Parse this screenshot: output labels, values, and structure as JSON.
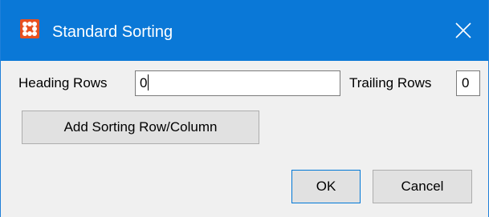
{
  "window": {
    "title": "Standard Sorting",
    "icon": "app-logo-icon",
    "close_icon": "close-icon",
    "titlebar_color": "#0a78d7",
    "icon_color": "#e8501f"
  },
  "form": {
    "heading_rows_label": "Heading Rows",
    "heading_rows_value": "0",
    "trailing_rows_label": "Trailing Rows",
    "trailing_rows_value": "0",
    "add_sorting_label": "Add Sorting Row/Column"
  },
  "footer": {
    "ok_label": "OK",
    "cancel_label": "Cancel"
  }
}
